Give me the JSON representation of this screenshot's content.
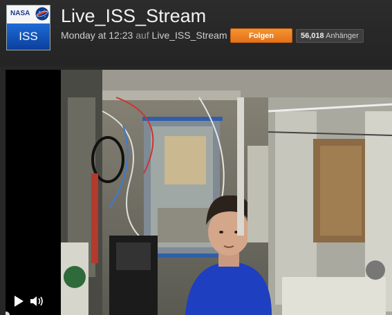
{
  "channel": {
    "logo_top_text": "NASA",
    "logo_bottom_text": "ISS",
    "title": "Live_ISS_Stream",
    "time_text": "Monday at 12:23",
    "on_text": "auf",
    "channel_link": "Live_ISS_Stream",
    "follow_label": "Folgen",
    "followers_count": "56,018",
    "followers_label": "Anhänger"
  },
  "player": {
    "play_icon": "play-icon",
    "volume_icon": "volume-icon"
  },
  "colors": {
    "follow_button": "#f08a24",
    "background": "#272727"
  }
}
